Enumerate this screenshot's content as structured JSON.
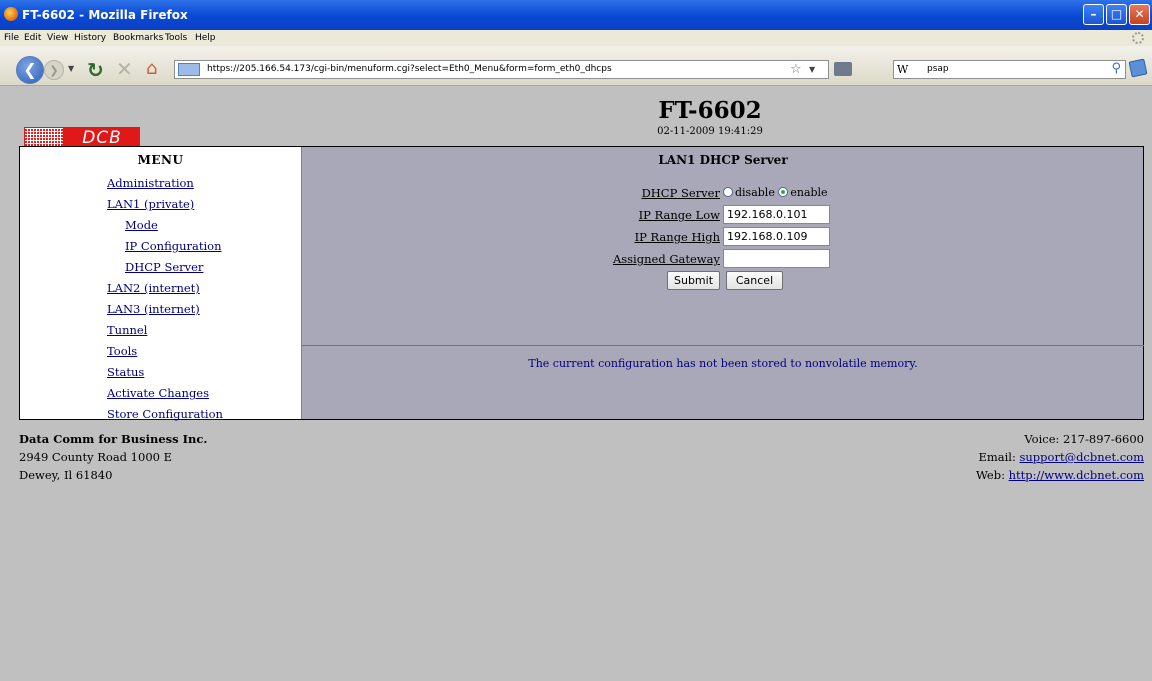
{
  "browser": {
    "window_title": "FT-6602 - Mozilla Firefox",
    "menus": [
      "File",
      "Edit",
      "View",
      "History",
      "Bookmarks",
      "Tools",
      "Help"
    ],
    "url": "https://205.166.54.173/cgi-bin/menuform.cgi?select=Eth0_Menu&form=form_eth0_dhcps",
    "search_engine": "W",
    "search_value": "psap"
  },
  "header": {
    "logo_text": "DCB",
    "device_name": "FT-6602",
    "datetime": "02-11-2009 19:41:29"
  },
  "menu": {
    "title": "MENU",
    "items": [
      {
        "label": "Administration"
      },
      {
        "label": "LAN1 (private)"
      },
      {
        "label": "Mode"
      },
      {
        "label": "IP Configuration"
      },
      {
        "label": "DHCP Server"
      },
      {
        "label": "LAN2 (internet)"
      },
      {
        "label": "LAN3 (internet)"
      },
      {
        "label": "Tunnel"
      },
      {
        "label": "Tools"
      },
      {
        "label": "Status"
      },
      {
        "label": "Activate Changes"
      },
      {
        "label": "Store Configuration"
      }
    ]
  },
  "form": {
    "title": "LAN1 DHCP Server",
    "dhcp_label": "DHCP Server",
    "opt_disable": "disable",
    "opt_enable": "enable",
    "dhcp_selected": "enable",
    "range_low_label": "IP Range Low",
    "range_low_value": "192.168.0.101",
    "range_high_label": "IP Range High",
    "range_high_value": "192.168.0.109",
    "gateway_label": "Assigned Gateway",
    "gateway_value": "",
    "submit": "Submit",
    "cancel": "Cancel",
    "status_message": "The current configuration has not been stored to nonvolatile memory."
  },
  "footer": {
    "company": "Data Comm for Business Inc.",
    "address1": "2949 County Road 1000 E",
    "address2": "Dewey, Il 61840",
    "voice": "Voice: 217-897-6600",
    "email_label": "Email: ",
    "email": "support@dcbnet.com",
    "web_label": "Web: ",
    "web": "http://www.dcbnet.com"
  }
}
